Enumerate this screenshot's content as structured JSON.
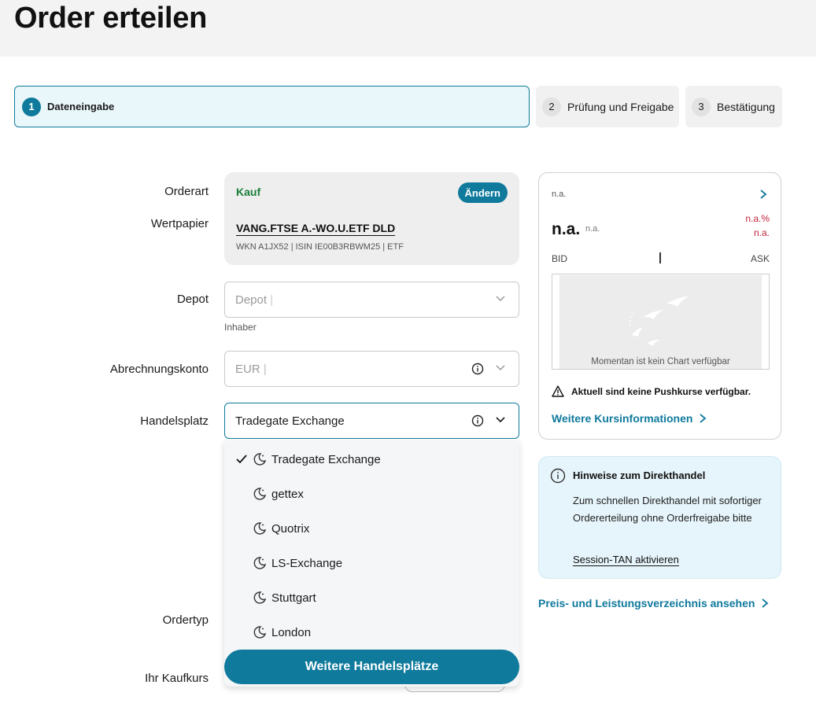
{
  "header": {
    "title": "Order erteilen"
  },
  "steps": [
    {
      "num": "1",
      "label": "Dateneingabe"
    },
    {
      "num": "2",
      "label": "Prüfung und Freigabe"
    },
    {
      "num": "3",
      "label": "Bestätigung"
    }
  ],
  "form": {
    "labels": {
      "orderart": "Orderart",
      "wertpapier": "Wertpapier",
      "depot": "Depot",
      "abrechnungskonto": "Abrechnungskonto",
      "handelsplatz": "Handelsplatz",
      "ordertyp": "Ordertyp",
      "kaufkurs": "Ihr Kaufkurs"
    },
    "orderart_value": "Kauf",
    "change_button": "Ändern",
    "security_name": "VANG.FTSE A.-WO.U.ETF DLD",
    "security_info": "WKN A1JX52 | ISIN IE00B3RBWM25 | ETF",
    "depot_placeholder": "Depot",
    "depot_sublabel": "Inhaber",
    "konto_value": "EUR",
    "handelsplatz_value": "Tradegate Exchange"
  },
  "dropdown": {
    "options": [
      "Tradegate Exchange",
      "gettex",
      "Quotrix",
      "LS-Exchange",
      "Stuttgart",
      "London"
    ],
    "selected_index": 0,
    "more_button": "Weitere Handelsplätze"
  },
  "quote": {
    "name": "n.a.",
    "price": "n.a.",
    "price_unit": "n.a.",
    "change_pct": "n.a.%",
    "change_abs": "n.a.",
    "bid_label": "BID",
    "ask_label": "ASK",
    "chart_message": "Momentan ist kein Chart verfügbar",
    "warning": "Aktuell sind keine Pushkurse verfügbar.",
    "more_link": "Weitere Kursinformationen",
    "change_color": "#c0243c"
  },
  "hint": {
    "title": "Hinweise zum Direkthandel",
    "body": "Zum schnellen Direkthandel mit sofortiger Ordererteilung ohne Orderfreigabe bitte",
    "link": "Session-TAN aktivieren"
  },
  "preis_link": "Preis- und Leistungsverzeichnis ansehen",
  "colors": {
    "accent": "#0f7a9c",
    "buy": "#1a7f3a"
  }
}
